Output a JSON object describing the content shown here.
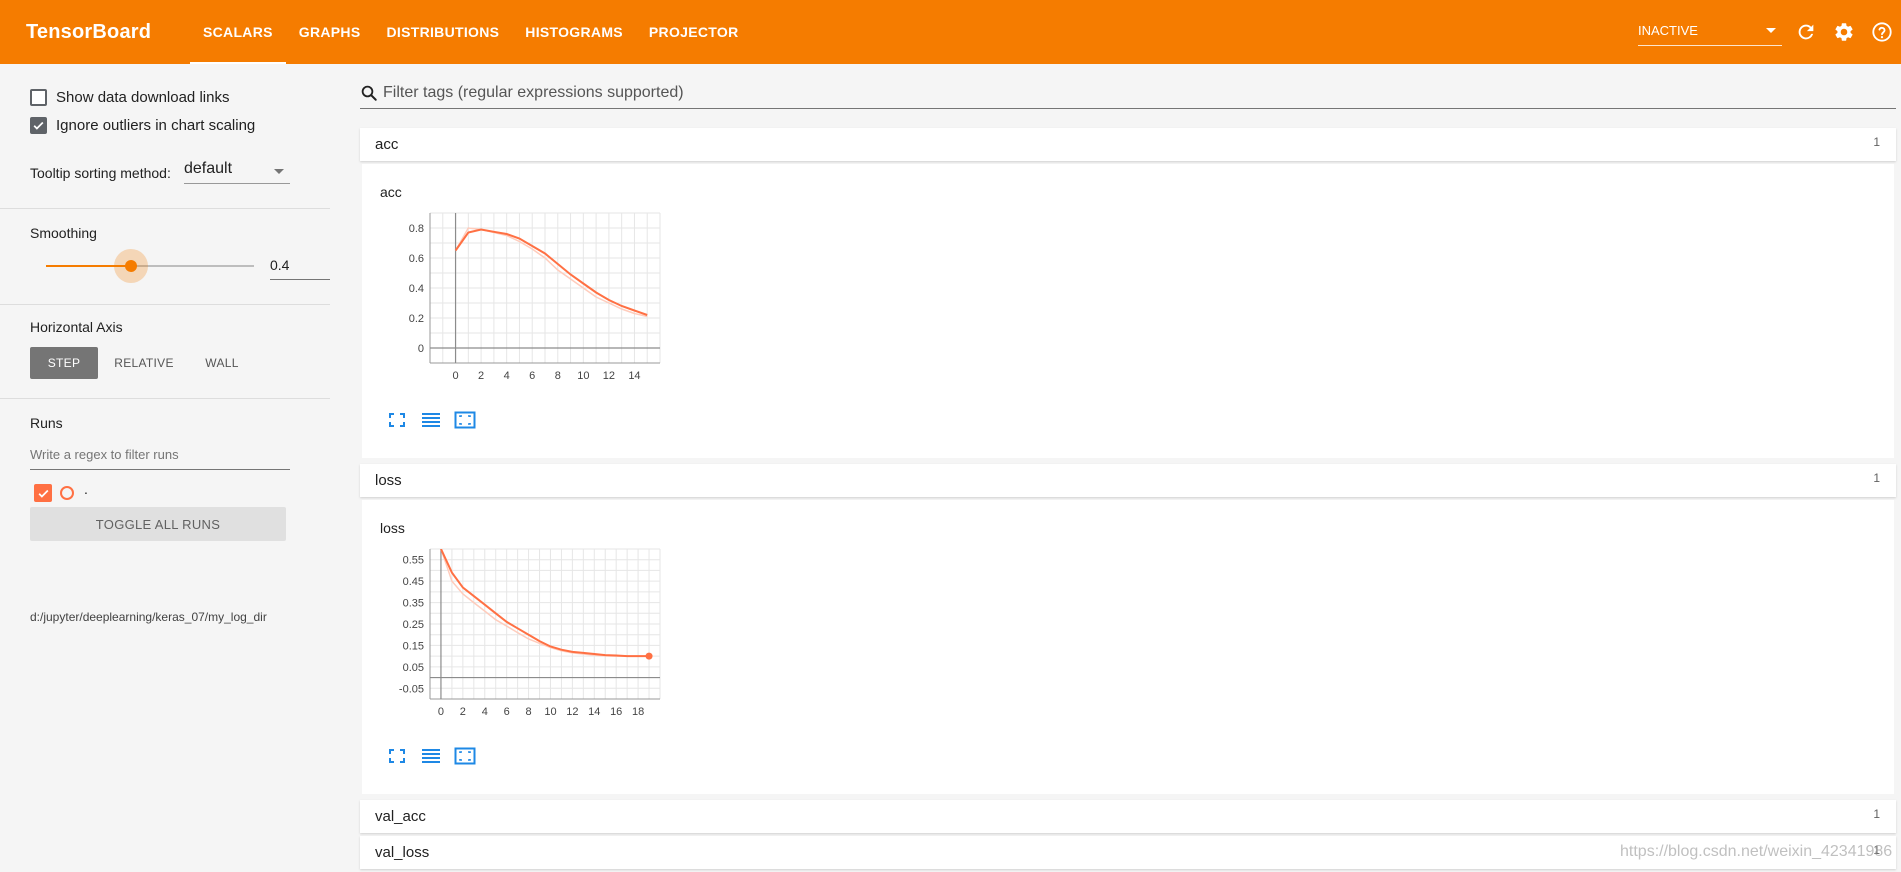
{
  "app": {
    "title": "TensorBoard",
    "brand_color": "#f57c00",
    "tabs": [
      {
        "label": "SCALARS",
        "active": true
      },
      {
        "label": "GRAPHS",
        "active": false
      },
      {
        "label": "DISTRIBUTIONS",
        "active": false
      },
      {
        "label": "HISTOGRAMS",
        "active": false
      },
      {
        "label": "PROJECTOR",
        "active": false
      }
    ],
    "status_value": "INACTIVE",
    "toolbar_icons": [
      "refresh-icon",
      "settings-gear-icon",
      "help-icon"
    ]
  },
  "sidebar": {
    "show_download_links": {
      "label": "Show data download links",
      "checked": false
    },
    "ignore_outliers": {
      "label": "Ignore outliers in chart scaling",
      "checked": true
    },
    "tooltip_sorting": {
      "label": "Tooltip sorting method:",
      "value": "default"
    },
    "smoothing": {
      "label": "Smoothing",
      "value": "0.4",
      "level": 0.4
    },
    "horizontal_axis": {
      "label": "Horizontal Axis",
      "options": [
        {
          "label": "STEP",
          "active": true
        },
        {
          "label": "RELATIVE",
          "active": false
        },
        {
          "label": "WALL",
          "active": false
        }
      ]
    },
    "runs": {
      "label": "Runs",
      "filter_placeholder": "Write a regex to filter runs",
      "items": [
        {
          "name": ".",
          "checked": true,
          "color": "#ff7043"
        }
      ],
      "toggle_all_label": "TOGGLE ALL RUNS",
      "log_dir": "d:/jupyter/deeplearning/keras_07/my_log_dir"
    }
  },
  "main": {
    "filter_placeholder": "Filter tags (regular expressions supported)",
    "cards": [
      {
        "name": "acc",
        "count": "1",
        "expanded": true
      },
      {
        "name": "loss",
        "count": "1",
        "expanded": true
      },
      {
        "name": "val_acc",
        "count": "1",
        "expanded": false
      },
      {
        "name": "val_loss",
        "count": "1",
        "expanded": false
      }
    ]
  },
  "chart_data": [
    {
      "type": "line",
      "title": "acc",
      "x": [
        0,
        1,
        2,
        3,
        4,
        5,
        6,
        7,
        8,
        9,
        10,
        11,
        12,
        13,
        14,
        15
      ],
      "series": [
        {
          "values": [
            0.65,
            0.77,
            0.79,
            0.775,
            0.76,
            0.73,
            0.68,
            0.63,
            0.56,
            0.49,
            0.43,
            0.37,
            0.32,
            0.28,
            0.25,
            0.22
          ],
          "color": "#ff7043"
        },
        {
          "values": [
            0.65,
            0.8,
            0.79,
            0.77,
            0.75,
            0.71,
            0.66,
            0.6,
            0.52,
            0.46,
            0.4,
            0.34,
            0.3,
            0.26,
            0.23,
            0.21
          ],
          "color": "#ffccbc"
        }
      ],
      "xticks": [
        "0",
        "2",
        "4",
        "6",
        "8",
        "10",
        "12",
        "14"
      ],
      "yticks": [
        "0",
        "0.2",
        "0.4",
        "0.6",
        "0.8"
      ],
      "xlim": [
        -2,
        16
      ],
      "ylim": [
        -0.1,
        0.9
      ]
    },
    {
      "type": "line",
      "title": "loss",
      "x": [
        0,
        1,
        2,
        3,
        4,
        5,
        6,
        7,
        8,
        9,
        10,
        11,
        12,
        13,
        14,
        15,
        16,
        17,
        18,
        19
      ],
      "series": [
        {
          "values": [
            0.6,
            0.49,
            0.42,
            0.38,
            0.34,
            0.3,
            0.26,
            0.23,
            0.2,
            0.17,
            0.145,
            0.13,
            0.12,
            0.115,
            0.11,
            0.105,
            0.103,
            0.1,
            0.1,
            0.1
          ],
          "color": "#ff7043"
        },
        {
          "values": [
            0.6,
            0.45,
            0.39,
            0.35,
            0.31,
            0.27,
            0.24,
            0.21,
            0.18,
            0.16,
            0.14,
            0.125,
            0.115,
            0.11,
            0.105,
            0.102,
            0.1,
            0.1,
            0.1,
            0.1
          ],
          "color": "#ffccbc"
        }
      ],
      "xticks": [
        "0",
        "2",
        "4",
        "6",
        "8",
        "10",
        "12",
        "14",
        "16",
        "18"
      ],
      "yticks": [
        "-0.05",
        "0.05",
        "0.15",
        "0.25",
        "0.35",
        "0.45",
        "0.55"
      ],
      "xlim": [
        -1,
        20
      ],
      "ylim": [
        -0.1,
        0.6
      ]
    }
  ],
  "watermark": "https://blog.csdn.net/weixin_42341986"
}
